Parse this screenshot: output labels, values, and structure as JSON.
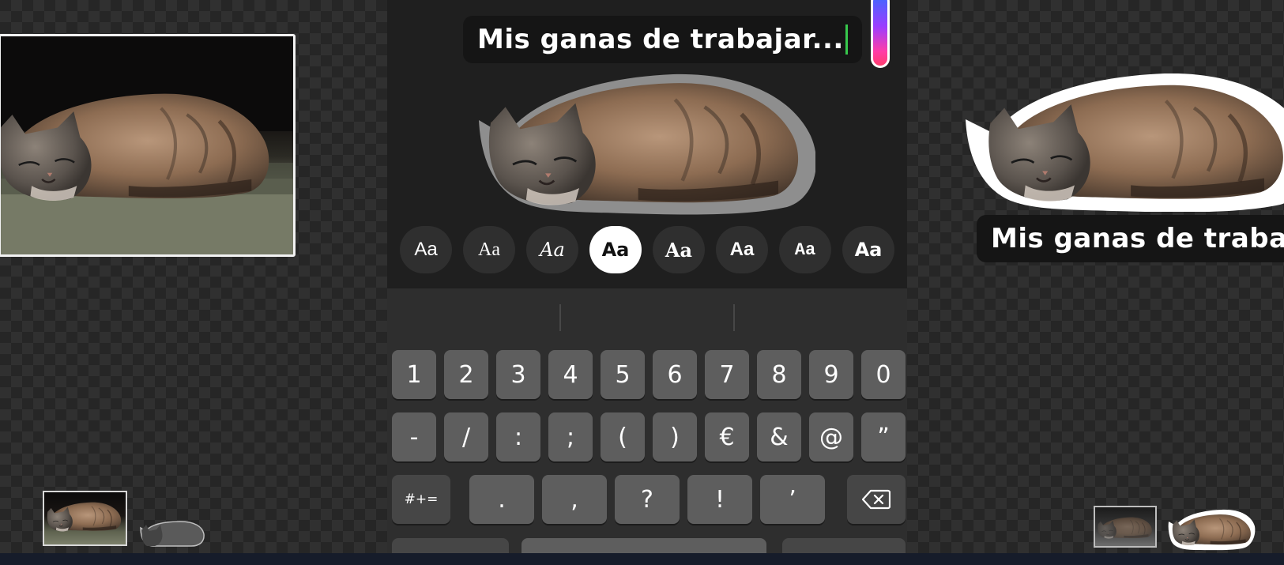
{
  "editor": {
    "caption_text": "Mis ganas de trabajar...",
    "right_caption_text": "Mis ganas de traba"
  },
  "font_styles": [
    {
      "label": "Aa",
      "selected": false
    },
    {
      "label": "Aa",
      "selected": false
    },
    {
      "label": "Aa",
      "selected": false
    },
    {
      "label": "Aa",
      "selected": true
    },
    {
      "label": "Aa",
      "selected": false
    },
    {
      "label": "Aa",
      "selected": false
    },
    {
      "label": "Aa",
      "selected": false
    },
    {
      "label": "Aa",
      "selected": false
    }
  ],
  "keyboard": {
    "row1": [
      "1",
      "2",
      "3",
      "4",
      "5",
      "6",
      "7",
      "8",
      "9",
      "0"
    ],
    "row2": [
      "-",
      "/",
      ":",
      ";",
      "(",
      ")",
      "€",
      "&",
      "@",
      "”"
    ],
    "row3_mode": "#+=",
    "row3": [
      ".",
      ",",
      "?",
      "!",
      "’"
    ],
    "delete_icon": "backspace-icon"
  },
  "colors": {
    "selected_chip_bg": "#ffffff",
    "cursor": "#37c74c",
    "slider_top": "#3d6bff",
    "slider_bottom": "#ff3d6e"
  }
}
